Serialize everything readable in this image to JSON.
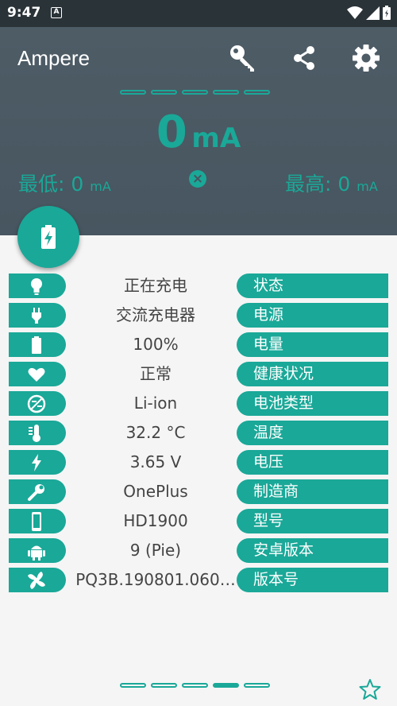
{
  "status_bar": {
    "time": "9:47",
    "notification_icon": "A"
  },
  "app": {
    "title": "Ampere"
  },
  "toolbar": {
    "icons": [
      "key-icon",
      "share-icon",
      "gear-icon"
    ]
  },
  "current": {
    "value": "0",
    "unit": "mA"
  },
  "min": {
    "label": "最低:",
    "value": "0",
    "unit": "mA"
  },
  "max": {
    "label": "最高:",
    "value": "0",
    "unit": "mA"
  },
  "rows": [
    {
      "icon": "bulb-icon",
      "value": "正在充电",
      "label": "状态"
    },
    {
      "icon": "plug-icon",
      "value": "交流充电器",
      "label": "电源"
    },
    {
      "icon": "battery-icon",
      "value": "100%",
      "label": "电量"
    },
    {
      "icon": "heart-icon",
      "value": "正常",
      "label": "健康状况"
    },
    {
      "icon": "battery-type-icon",
      "value": "Li-ion",
      "label": "电池类型"
    },
    {
      "icon": "thermometer-icon",
      "value": "32.2 °C",
      "label": "温度"
    },
    {
      "icon": "lightning-icon",
      "value": "3.65 V",
      "label": "电压"
    },
    {
      "icon": "wrench-icon",
      "value": "OnePlus",
      "label": "制造商"
    },
    {
      "icon": "phone-icon",
      "value": "HD1900",
      "label": "型号"
    },
    {
      "icon": "android-icon",
      "value": "9 (Pie)",
      "label": "安卓版本"
    },
    {
      "icon": "fan-icon",
      "value": "PQ3B.190801.060…",
      "label": "版本号"
    }
  ],
  "top_pager": {
    "count": 5,
    "active": null
  },
  "bottom_pager": {
    "count": 5,
    "active": 3
  },
  "colors": {
    "accent": "#1aa898",
    "header": "#4e5c66",
    "background": "#f5f5f5"
  }
}
